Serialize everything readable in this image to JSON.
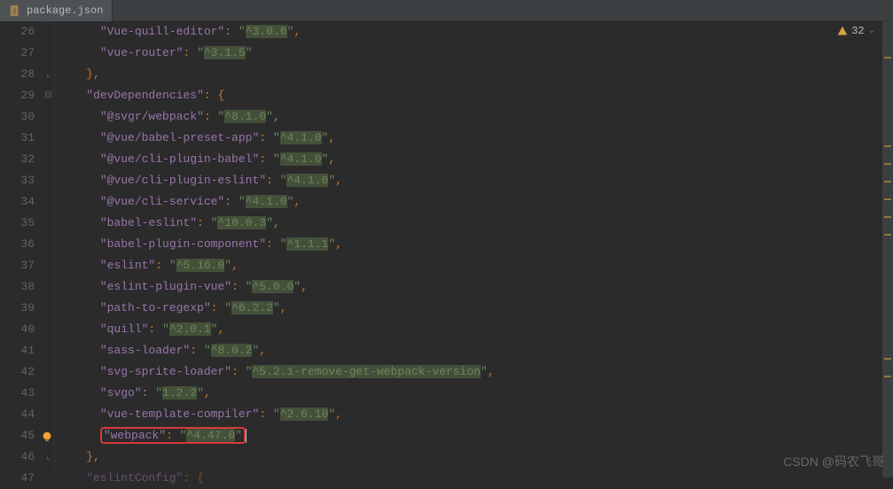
{
  "tab": {
    "filename": "package.json"
  },
  "warnings": {
    "count": "32"
  },
  "watermark": "CSDN @码农飞哥",
  "gutter_start": 26,
  "lines": [
    {
      "n": 26,
      "indent": 3,
      "key": "Vue-quill-editor",
      "val": "^3.0.6",
      "hl": true,
      "trail": ","
    },
    {
      "n": 27,
      "indent": 3,
      "key": "vue-router",
      "val": "^3.1.5",
      "hl": true,
      "trail": ""
    },
    {
      "n": 28,
      "indent": 2,
      "raw": "},",
      "fold": "end"
    },
    {
      "n": 29,
      "indent": 2,
      "key": "devDependencies",
      "open": true,
      "fold": "start"
    },
    {
      "n": 30,
      "indent": 3,
      "key": "@svgr/webpack",
      "val": "^8.1.0",
      "hl": true,
      "trail": ","
    },
    {
      "n": 31,
      "indent": 3,
      "key": "@vue/babel-preset-app",
      "val": "^4.1.0",
      "hl": true,
      "trail": ","
    },
    {
      "n": 32,
      "indent": 3,
      "key": "@vue/cli-plugin-babel",
      "val": "^4.1.0",
      "hl": true,
      "trail": ","
    },
    {
      "n": 33,
      "indent": 3,
      "key": "@vue/cli-plugin-eslint",
      "val": "^4.1.0",
      "hl": true,
      "trail": ","
    },
    {
      "n": 34,
      "indent": 3,
      "key": "@vue/cli-service",
      "val": "^4.1.0",
      "hl": true,
      "trail": ","
    },
    {
      "n": 35,
      "indent": 3,
      "key": "babel-eslint",
      "val": "^10.0.3",
      "hl": true,
      "trail": ","
    },
    {
      "n": 36,
      "indent": 3,
      "key": "babel-plugin-component",
      "val": "^1.1.1",
      "hl": true,
      "trail": ","
    },
    {
      "n": 37,
      "indent": 3,
      "key": "eslint",
      "val": "^5.16.0",
      "hl": true,
      "trail": ","
    },
    {
      "n": 38,
      "indent": 3,
      "key": "eslint-plugin-vue",
      "val": "^5.0.0",
      "hl": true,
      "trail": ","
    },
    {
      "n": 39,
      "indent": 3,
      "key": "path-to-regexp",
      "val": "^6.2.2",
      "hl": true,
      "trail": ","
    },
    {
      "n": 40,
      "indent": 3,
      "key": "quill",
      "val": "^2.0.1",
      "hl": true,
      "trail": ","
    },
    {
      "n": 41,
      "indent": 3,
      "key": "sass-loader",
      "val": "^8.0.2",
      "hl": true,
      "trail": ","
    },
    {
      "n": 42,
      "indent": 3,
      "key": "svg-sprite-loader",
      "val": "^5.2.1-remove-get-webpack-version",
      "hl": true,
      "trail": ","
    },
    {
      "n": 43,
      "indent": 3,
      "key": "svgo",
      "val": "1.2.2",
      "hl": true,
      "trail": ","
    },
    {
      "n": 44,
      "indent": 3,
      "key": "vue-template-compiler",
      "val": "^2.6.10",
      "hl": true,
      "trail": ","
    },
    {
      "n": 45,
      "indent": 3,
      "key": "webpack",
      "val": "^4.47.0",
      "hl": true,
      "trail": "",
      "redbox": true,
      "cursor": true,
      "bulb": true
    },
    {
      "n": 46,
      "indent": 2,
      "raw": "},",
      "fold": "end"
    },
    {
      "n": 47,
      "indent": 2,
      "key": "eslintConfig",
      "open": true,
      "cutoff": true
    }
  ]
}
